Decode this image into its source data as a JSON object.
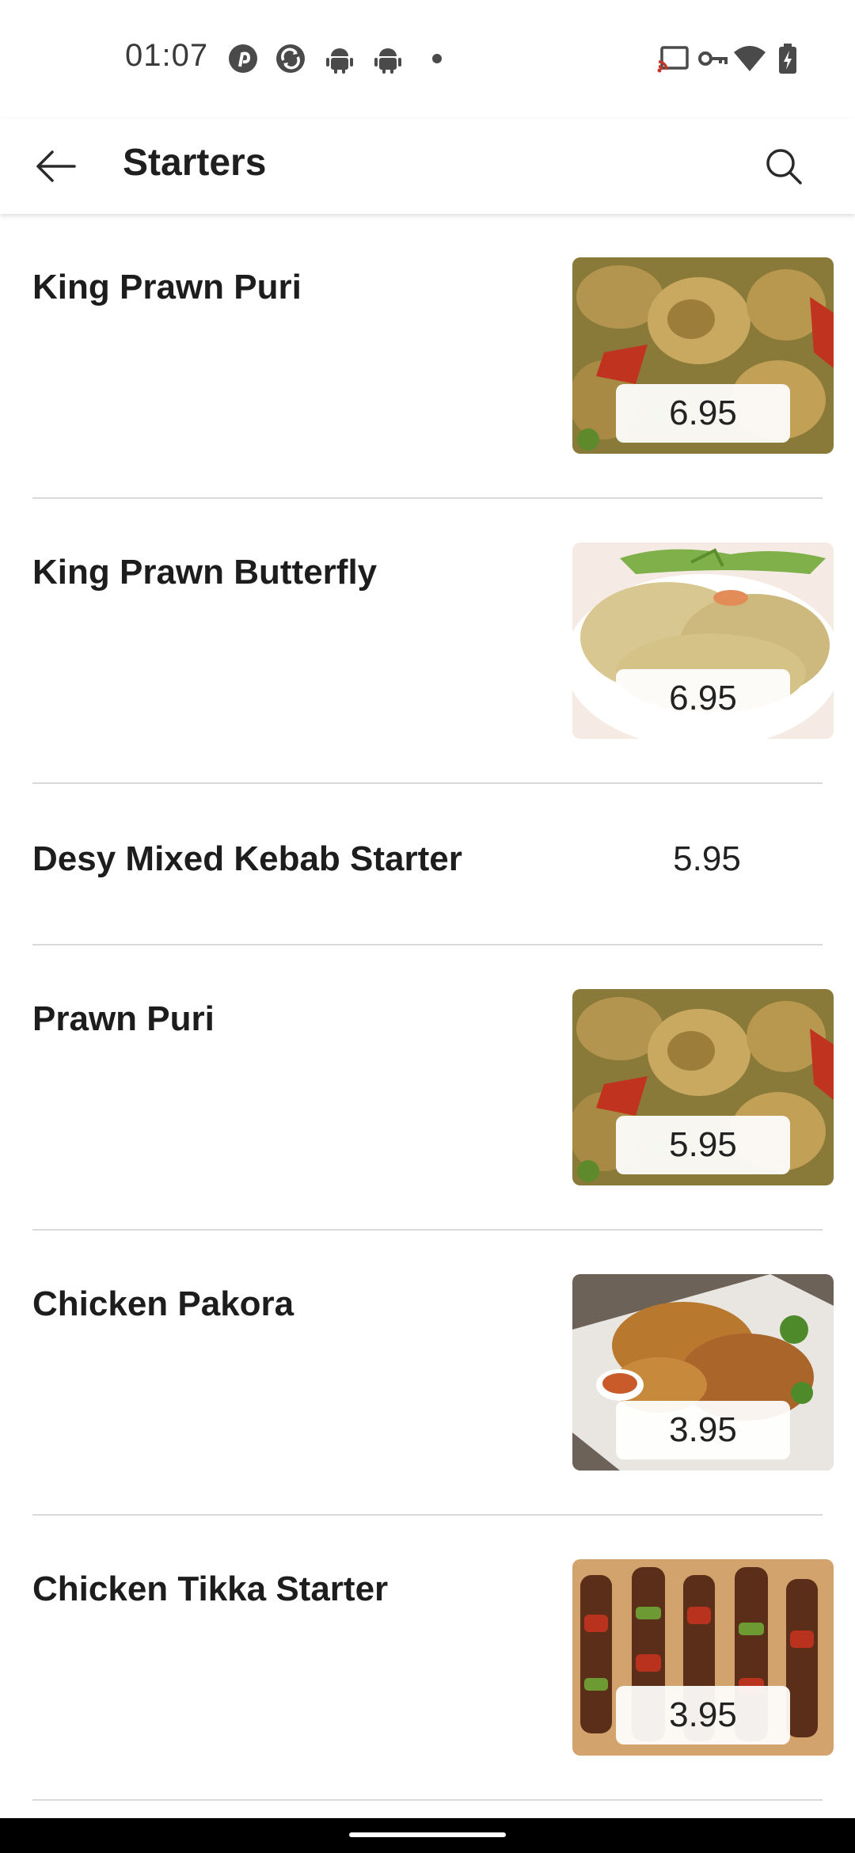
{
  "status_bar": {
    "time": "01:07",
    "left_icons": [
      "pinterest-icon",
      "sync-icon",
      "android-icon",
      "android-icon",
      "dot-icon"
    ],
    "right_icons": [
      "cast-icon",
      "vpn-key-icon",
      "wifi-icon",
      "battery-charging-icon"
    ]
  },
  "app_bar": {
    "title": "Starters",
    "back_icon": "arrow-back-icon",
    "search_icon": "search-icon"
  },
  "items": [
    {
      "name": "King Prawn Puri",
      "price": "6.95",
      "image": "prawn-curry"
    },
    {
      "name": "King Prawn Butterfly",
      "price": "6.95",
      "image": "breaded-prawn"
    },
    {
      "name": "Desy Mixed Kebab Starter",
      "price": "5.95",
      "image": null
    },
    {
      "name": "Prawn Puri",
      "price": "5.95",
      "image": "prawn-curry"
    },
    {
      "name": "Chicken Pakora",
      "price": "3.95",
      "image": "fried-pakora"
    },
    {
      "name": "Chicken Tikka Starter",
      "price": "3.95",
      "image": "tikka-skewers"
    }
  ],
  "colors": {
    "divider": "#d9d9d9",
    "text": "#1d1d1d",
    "background": "#ffffff"
  }
}
